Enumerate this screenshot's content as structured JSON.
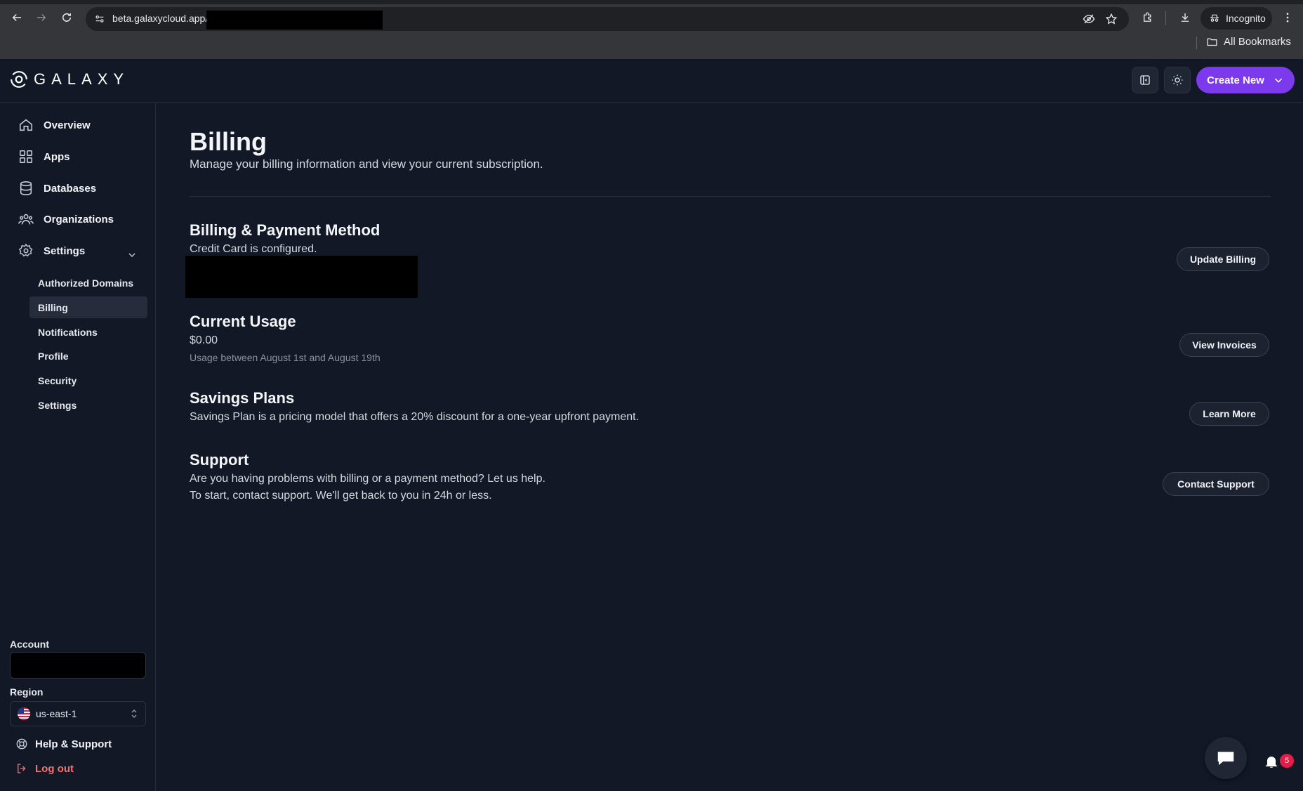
{
  "browser": {
    "url": "beta.galaxycloud.app/",
    "incognito_label": "Incognito",
    "bookmarks_label": "All Bookmarks"
  },
  "header": {
    "logo_text": "GALAXY",
    "create_button_label": "Create New"
  },
  "sidebar": {
    "nav": {
      "overview": "Overview",
      "apps": "Apps",
      "databases": "Databases",
      "organizations": "Organizations",
      "settings": "Settings"
    },
    "settings_items": {
      "authorized_domains": "Authorized Domains",
      "billing": "Billing",
      "notifications": "Notifications",
      "profile": "Profile",
      "security": "Security",
      "settings": "Settings"
    },
    "account_label": "Account",
    "region_label": "Region",
    "region_value": "us-east-1",
    "help_label": "Help & Support",
    "logout_label": "Log out"
  },
  "main": {
    "title": "Billing",
    "subtitle": "Manage your billing information and view your current subscription.",
    "billing_method": {
      "title": "Billing & Payment Method",
      "status": "Credit Card is configured.",
      "button": "Update Billing"
    },
    "usage": {
      "title": "Current Usage",
      "amount": "$0.00",
      "period": "Usage between August 1st and August 19th",
      "button": "View Invoices"
    },
    "savings": {
      "title": "Savings Plans",
      "text": "Savings Plan is a pricing model that offers a 20% discount for a one-year upfront payment.",
      "button": "Learn More"
    },
    "support": {
      "title": "Support",
      "line1": "Are you having problems with billing or a payment method? Let us help.",
      "line2": "To start, contact support. We'll get back to you in 24h or less.",
      "button": "Contact Support"
    }
  },
  "notifications": {
    "count": "5"
  },
  "colors": {
    "accent": "#7c3aed",
    "background": "#121826",
    "logout": "#f87171",
    "badge": "#e11d48"
  }
}
